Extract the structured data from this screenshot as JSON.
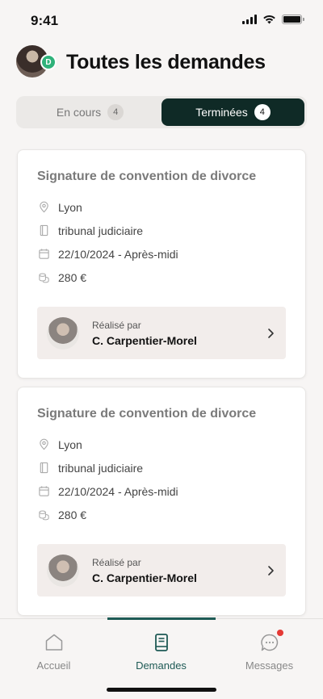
{
  "status_bar": {
    "time": "9:41"
  },
  "header": {
    "title": "Toutes les demandes",
    "avatar_badge": "D"
  },
  "tabs_filter": [
    {
      "label": "En cours",
      "count": "4",
      "active": false
    },
    {
      "label": "Terminées",
      "count": "4",
      "active": true
    }
  ],
  "cards": [
    {
      "title": "Signature de convention de divorce",
      "city": "Lyon",
      "court": "tribunal judiciaire",
      "date": "22/10/2024 - Après-midi",
      "price": "280 €",
      "realise_label": "Réalisé par",
      "realise_name": "C. Carpentier-Morel"
    },
    {
      "title": "Signature de convention de divorce",
      "city": "Lyon",
      "court": "tribunal judiciaire",
      "date": "22/10/2024 - Après-midi",
      "price": "280 €",
      "realise_label": "Réalisé par",
      "realise_name": "C. Carpentier-Morel"
    }
  ],
  "tab_bar": [
    {
      "label": "Accueil",
      "icon": "home-icon",
      "active": false
    },
    {
      "label": "Demandes",
      "icon": "book-icon",
      "active": true
    },
    {
      "label": "Messages",
      "icon": "chat-icon",
      "active": false,
      "notification": true
    }
  ],
  "colors": {
    "accent": "#0f2a26",
    "tab_active": "#1e5a55",
    "badge": "#2fb27a",
    "notification": "#e53935"
  }
}
